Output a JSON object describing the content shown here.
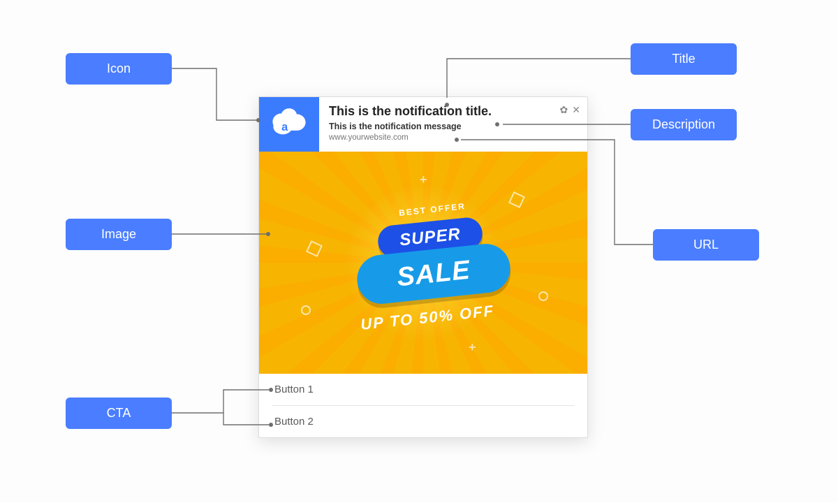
{
  "labels": {
    "icon": "Icon",
    "title": "Title",
    "description": "Description",
    "url": "URL",
    "image": "Image",
    "cta": "CTA"
  },
  "notification": {
    "title": "This is the notification title.",
    "message": "This is the notification message",
    "url": "www.yourwebsite.com",
    "buttons": {
      "b1": "Button 1",
      "b2": "Button 2"
    }
  },
  "promo": {
    "best_offer": "BEST OFFER",
    "super": "SUPER",
    "sale": "SALE",
    "upto": "UP TO 50% OFF"
  },
  "colors": {
    "pill": "#4A7DFF",
    "iconbg": "#3B7CFF",
    "promo_bg": "#F7B401",
    "badge_dark": "#1D50E7",
    "badge_light": "#179BE8"
  }
}
